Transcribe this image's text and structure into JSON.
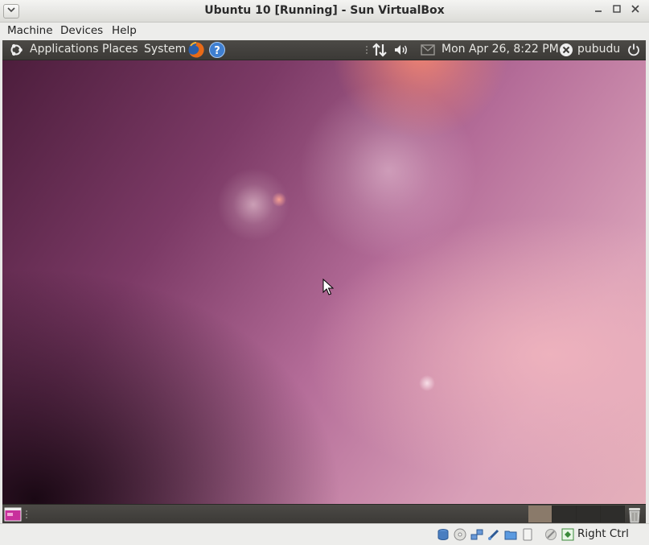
{
  "window": {
    "title": "Ubuntu 10 [Running] - Sun VirtualBox",
    "menu": [
      "Machine",
      "Devices",
      "Help"
    ]
  },
  "top_panel": {
    "menus": [
      "Applications",
      "Places",
      "System"
    ],
    "clock": "Mon Apr 26,  8:22 PM",
    "user": "pubudu"
  },
  "statusbar": {
    "host_key": "Right Ctrl"
  },
  "icons": {
    "ubuntu_logo": "ubuntu-logo-icon",
    "firefox": "firefox-icon",
    "help": "help-icon",
    "network": "network-updown-icon",
    "volume": "volume-icon",
    "mail": "mail-icon",
    "user": "user-status-icon",
    "power": "power-icon",
    "trash": "trash-icon",
    "show_desktop": "show-desktop-icon"
  },
  "colors": {
    "panel": "#3b3936",
    "desktop_accent": "#7c3a66"
  }
}
